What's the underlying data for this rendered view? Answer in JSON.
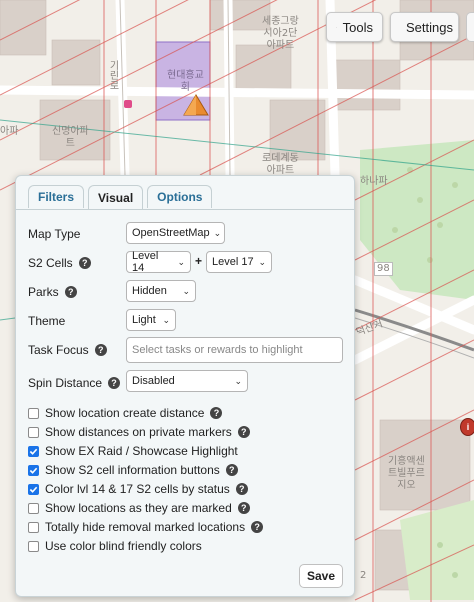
{
  "top_buttons": {
    "tools_label": "Tools",
    "settings_label": "Settings"
  },
  "map": {
    "labels": {
      "complex1": "세종그랑\n시아2단\n아파트",
      "complex2": "현대흥교\n회",
      "complex3": "신명아파\n트",
      "apt": "아파",
      "road": "기린로",
      "complex4": "로데계동\n아파트",
      "complex5": "하나파",
      "road2": "덕산거",
      "road_num": "98",
      "complex6": "기흥액센\n트빌푸르\n지오",
      "num2": "2"
    }
  },
  "panel": {
    "tabs": [
      "Filters",
      "Visual",
      "Options"
    ],
    "active_tab": "Visual",
    "map_type": {
      "label": "Map Type",
      "value": "OpenStreetMap"
    },
    "s2_cells": {
      "label": "S2 Cells",
      "value1": "Level 14",
      "plus": "+",
      "value2": "Level 17"
    },
    "parks": {
      "label": "Parks",
      "value": "Hidden"
    },
    "theme": {
      "label": "Theme",
      "value": "Light"
    },
    "task_focus": {
      "label": "Task Focus",
      "placeholder": "Select tasks or rewards to highlight"
    },
    "spin_distance": {
      "label": "Spin Distance",
      "value": "Disabled"
    },
    "checkboxes": [
      {
        "label": "Show location create distance",
        "checked": false,
        "help": true
      },
      {
        "label": "Show distances on private markers",
        "checked": false,
        "help": true
      },
      {
        "label": "Show EX Raid / Showcase Highlight",
        "checked": true,
        "help": false
      },
      {
        "label": "Show S2 cell information buttons",
        "checked": true,
        "help": true
      },
      {
        "label": "Color lvl 14 & 17 S2 cells by status",
        "checked": true,
        "help": true
      },
      {
        "label": "Show locations as they are marked",
        "checked": false,
        "help": true
      },
      {
        "label": "Totally hide removal marked locations",
        "checked": false,
        "help": true
      },
      {
        "label": "Use color blind friendly colors",
        "checked": false,
        "help": false
      }
    ],
    "save_label": "Save"
  },
  "colors": {
    "accent": "#1a73e8",
    "tab_link": "#2a6f97",
    "s2_lines": "#d9534f",
    "highlight_cell": "#b89be0"
  }
}
